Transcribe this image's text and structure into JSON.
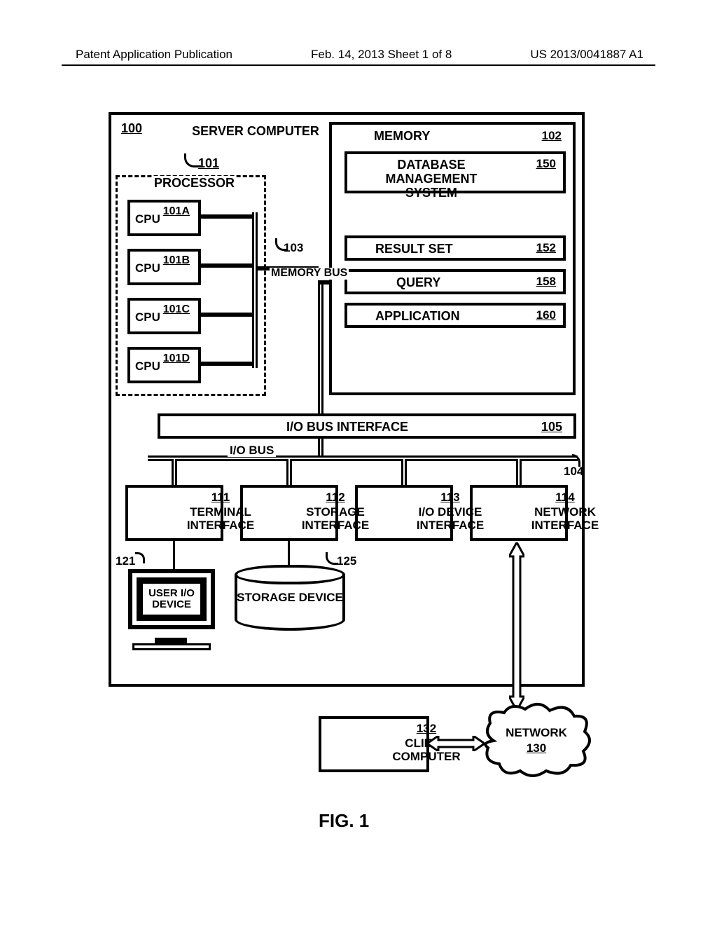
{
  "header": {
    "left": "Patent Application Publication",
    "center": "Feb. 14, 2013  Sheet 1 of 8",
    "right": "US 2013/0041887 A1"
  },
  "figure_label": "FIG. 1",
  "refs": {
    "system": "100",
    "processor": "101",
    "cpu_a": "101A",
    "cpu_b": "101B",
    "cpu_c": "101C",
    "cpu_d": "101D",
    "memory": "102",
    "memory_bus": "103",
    "io_bus": "104",
    "io_bus_if": "105",
    "terminal_if": "111",
    "storage_if": "112",
    "iodevice_if": "113",
    "network_if": "114",
    "user_io": "121",
    "storage_dev": "125",
    "network": "130",
    "client": "132",
    "dbms": "150",
    "result_set": "152",
    "query": "158",
    "application": "160"
  },
  "labels": {
    "server_computer": "SERVER COMPUTER",
    "processor": "PROCESSOR",
    "cpu": "CPU",
    "memory": "MEMORY",
    "dbms": "DATABASE MANAGEMENT SYSTEM",
    "result_set": "RESULT SET",
    "query": "QUERY",
    "application": "APPLICATION",
    "memory_bus": "MEMORY BUS",
    "io_bus_if": "I/O BUS INTERFACE",
    "io_bus": "I/O BUS",
    "terminal_if": "TERMINAL INTERFACE",
    "storage_if": "STORAGE INTERFACE",
    "iodevice_if": "I/O DEVICE INTERFACE",
    "network_if": "NETWORK INTERFACE",
    "user_io": "USER I/O DEVICE",
    "storage_dev": "STORAGE DEVICE",
    "client": "CLIENT COMPUTER",
    "network": "NETWORK"
  }
}
